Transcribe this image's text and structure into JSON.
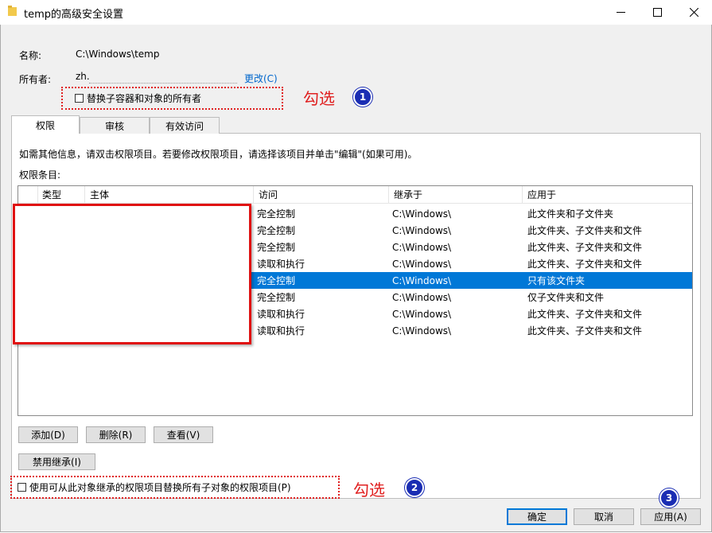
{
  "window": {
    "title": "temp的高级安全设置",
    "minimize_icon": "minimize-icon",
    "maximize_icon": "maximize-icon",
    "close_icon": "close-icon"
  },
  "fields": {
    "name_label": "名称:",
    "name_value": "C:\\Windows\\temp",
    "owner_label": "所有者:",
    "owner_value": "zh.",
    "change_link": "更改(C)",
    "replace_owner_checkbox": "替换子容器和对象的所有者"
  },
  "annotations": {
    "check1": "勾选",
    "badge1": "1",
    "check2": "勾选",
    "badge2": "2",
    "badge3": "3",
    "accent": "#e02020",
    "badge_color": "#1a2db3"
  },
  "tabs": [
    "权限",
    "审核",
    "有效访问"
  ],
  "info_text": "如需其他信息，请双击权限项目。若要修改权限项目，请选择该项目并单击\"编辑\"(如果可用)。",
  "entries_label": "权限条目:",
  "table": {
    "headers": [
      "类型",
      "主体",
      "访问",
      "继承于",
      "应用于"
    ],
    "rows": [
      {
        "access": "完全控制",
        "inherit": "C:\\Windows\\",
        "apply": "此文件夹和子文件夹",
        "selected": false
      },
      {
        "access": "完全控制",
        "inherit": "C:\\Windows\\",
        "apply": "此文件夹、子文件夹和文件",
        "selected": false
      },
      {
        "access": "完全控制",
        "inherit": "C:\\Windows\\",
        "apply": "此文件夹、子文件夹和文件",
        "selected": false
      },
      {
        "access": "读取和执行",
        "inherit": "C:\\Windows\\",
        "apply": "此文件夹、子文件夹和文件",
        "selected": false
      },
      {
        "access": "完全控制",
        "inherit": "C:\\Windows\\",
        "apply": "只有该文件夹",
        "selected": true
      },
      {
        "access": "完全控制",
        "inherit": "C:\\Windows\\",
        "apply": "仅子文件夹和文件",
        "selected": false
      },
      {
        "access": "读取和执行",
        "inherit": "C:\\Windows\\",
        "apply": "此文件夹、子文件夹和文件",
        "selected": false
      },
      {
        "access": "读取和执行",
        "inherit": "C:\\Windows\\",
        "apply": "此文件夹、子文件夹和文件",
        "selected": false
      }
    ],
    "selection_color": "#0078d7"
  },
  "buttons": {
    "add": "添加(D)",
    "remove": "删除(R)",
    "view": "查看(V)",
    "disable_inheritance": "禁用继承(I)",
    "replace_child_checkbox": "使用可从此对象继承的权限项目替换所有子对象的权限项目(P)",
    "ok": "确定",
    "cancel": "取消",
    "apply": "应用(A)"
  }
}
